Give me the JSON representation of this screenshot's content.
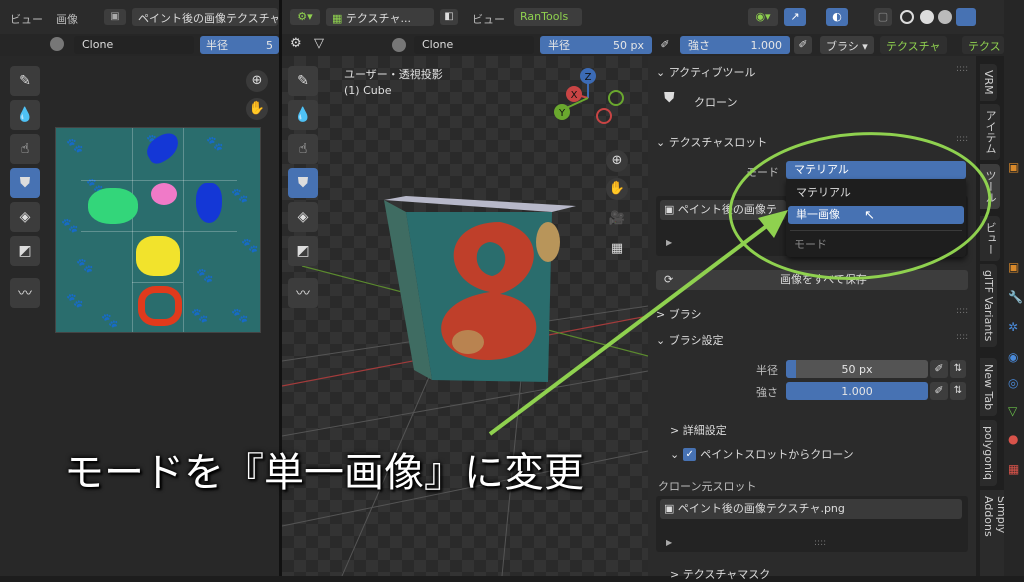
{
  "left_editor": {
    "menu_view": "ビュー",
    "menu_image": "画像",
    "image_name": "ペイント後の画像テクスチャ",
    "brush_name": "Clone",
    "radius_label": "半径",
    "radius_value": "5"
  },
  "viewport": {
    "mode_label": "テクスチャ...",
    "menu_view": "ビュー",
    "addon_tab": "RanTools",
    "brush_name": "Clone",
    "radius_label": "半径",
    "radius_value": "50 px",
    "strength_label": "強さ",
    "strength_value": "1.000",
    "brush_menu": "ブラシ",
    "texture_menu": "テクスチャ",
    "texture_menu2": "テクス",
    "overlay_title": "ユーザー・透視投影",
    "overlay_object": "(1) Cube",
    "axis_x": "X",
    "axis_y": "Y",
    "axis_z": "Z"
  },
  "sidebar": {
    "active_tool_header": "アクティブツール",
    "active_tool_name": "クローン",
    "texture_slots_header": "テクスチャスロット",
    "mode_label": "モード",
    "mode_value": "マテリアル",
    "dropdown_options": [
      "マテリアル",
      "単一画像"
    ],
    "dropdown_footer": "モード",
    "slot_image": "ペイント後の画像テ",
    "save_all": "画像をすべて保存",
    "brush_header": "ブラシ",
    "brush_settings_header": "ブラシ設定",
    "radius_label": "半径",
    "radius_value": "50 px",
    "strength_label": "強さ",
    "strength_value": "1.000",
    "advanced": "詳細設定",
    "clone_from_slot": "ペイントスロットからクローン",
    "clone_source_label": "クローン元スロット",
    "clone_source_image": "ペイント後の画像テクスチャ.png",
    "texture_mask": "テクスチャマスク",
    "dots": "::::"
  },
  "vertical_tabs": [
    "VRM",
    "アイテム",
    "ツール",
    "ビュー",
    "glTF Variants",
    "New Tab",
    "polygoniq",
    "Simply Addons"
  ],
  "caption": "モードを『単一画像』に変更",
  "colors": {
    "accent_blue": "#4772b3",
    "annotation_green": "#8fd14f",
    "cube_teal": "#2a6d6d"
  }
}
